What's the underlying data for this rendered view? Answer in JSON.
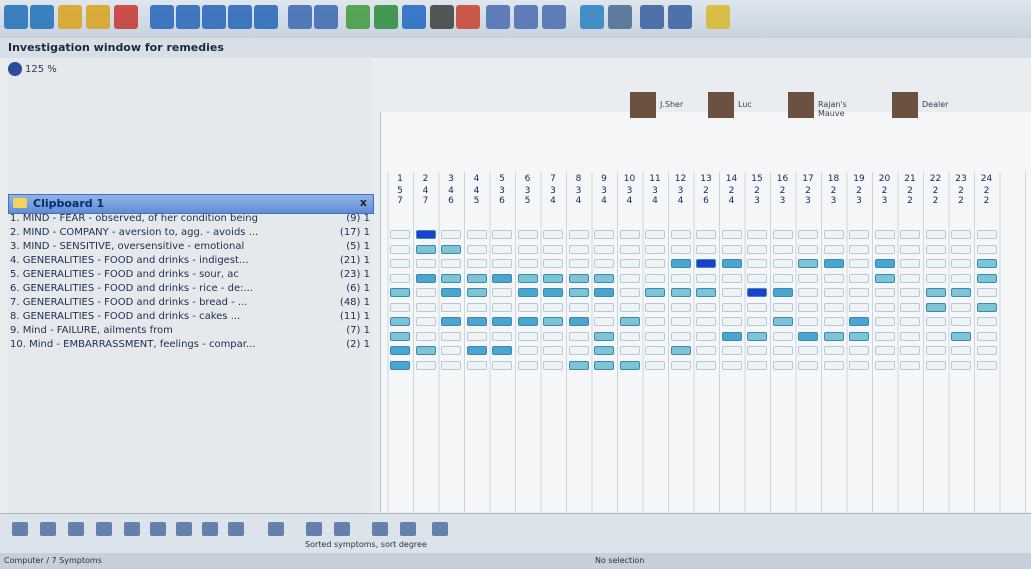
{
  "window": {
    "title": "Investigation window for remedies",
    "zoom": "125 %"
  },
  "toolbar": {
    "icons": [
      "binoculars-icon",
      "search-icon",
      "lightbulb-icon",
      "lightbulb-question-icon",
      "run-icon",
      "book1-icon",
      "book2-icon",
      "book3-icon",
      "book4-icon",
      "book5-icon",
      "chart-icon",
      "figure-icon",
      "plant-icon",
      "mushroom-icon",
      "sync-icon",
      "calendar-23-icon",
      "pencil-icon",
      "repertory1-icon",
      "repertory2-icon",
      "repertory3-icon",
      "globe-icon",
      "printer-icon",
      "network1-icon",
      "network2-icon",
      "help-icon"
    ]
  },
  "users": [
    {
      "name": "J.Sher"
    },
    {
      "name": "Luc"
    },
    {
      "name": "Rajan's Mauve"
    },
    {
      "name": "Dealer"
    }
  ],
  "clipboard": {
    "title": "Clipboard 1",
    "rubrics": [
      {
        "text": "1. MIND - FEAR - observed, of her condition being",
        "count": "(9) 1"
      },
      {
        "text": "2. MIND - COMPANY - aversion to, agg. - avoids ...",
        "count": "(17) 1"
      },
      {
        "text": "3. MIND - SENSITIVE, oversensitive - emotional",
        "count": "(5) 1"
      },
      {
        "text": "4. GENERALITIES - FOOD and drinks - indigest...",
        "count": "(21) 1"
      },
      {
        "text": "5. GENERALITIES - FOOD and drinks - sour, ac",
        "count": "(23) 1"
      },
      {
        "text": "6. GENERALITIES - FOOD and drinks - rice - de:...",
        "count": "(6) 1"
      },
      {
        "text": "7. GENERALITIES - FOOD and drinks - bread - ...",
        "count": "(48) 1"
      },
      {
        "text": "8. GENERALITIES - FOOD and drinks - cakes ...",
        "count": "(11) 1"
      },
      {
        "text": "9. Mind - FAILURE, ailments from",
        "count": "(7) 1"
      },
      {
        "text": "10. Mind - EMBARRASSMENT, feelings - compar...",
        "count": "(2) 1"
      }
    ]
  },
  "grid": {
    "remedy_columns": [
      "1",
      "2",
      "3",
      "4",
      "5",
      "6",
      "7",
      "8",
      "9",
      "10",
      "11",
      "12",
      "13",
      "14",
      "15",
      "16",
      "17",
      "18",
      "19",
      "20",
      "21",
      "22",
      "23",
      "24"
    ],
    "scores_top": [
      "5",
      "4",
      "4",
      "4",
      "3",
      "3",
      "3",
      "3",
      "3",
      "3",
      "3",
      "3",
      "2",
      "2",
      "2",
      "2",
      "2",
      "2",
      "2",
      "2",
      "2",
      "2",
      "2",
      "2"
    ],
    "scores_bottom": [
      "7",
      "7",
      "6",
      "5",
      "6",
      "5",
      "4",
      "4",
      "4",
      "4",
      "4",
      "4",
      "6",
      "4",
      "3",
      "3",
      "3",
      "3",
      "3",
      "3",
      "2",
      "2",
      "2",
      "2"
    ]
  },
  "colors": {
    "light": "#cfe9ea",
    "mid": "#7cc4d6",
    "strong": "#4aa6d0",
    "dark": "#1a3fd1"
  },
  "bottom": {
    "hint": "Sorted symptoms, sort degree",
    "status_center": "No selection",
    "status_left": "Computer / 7 Symptoms"
  }
}
